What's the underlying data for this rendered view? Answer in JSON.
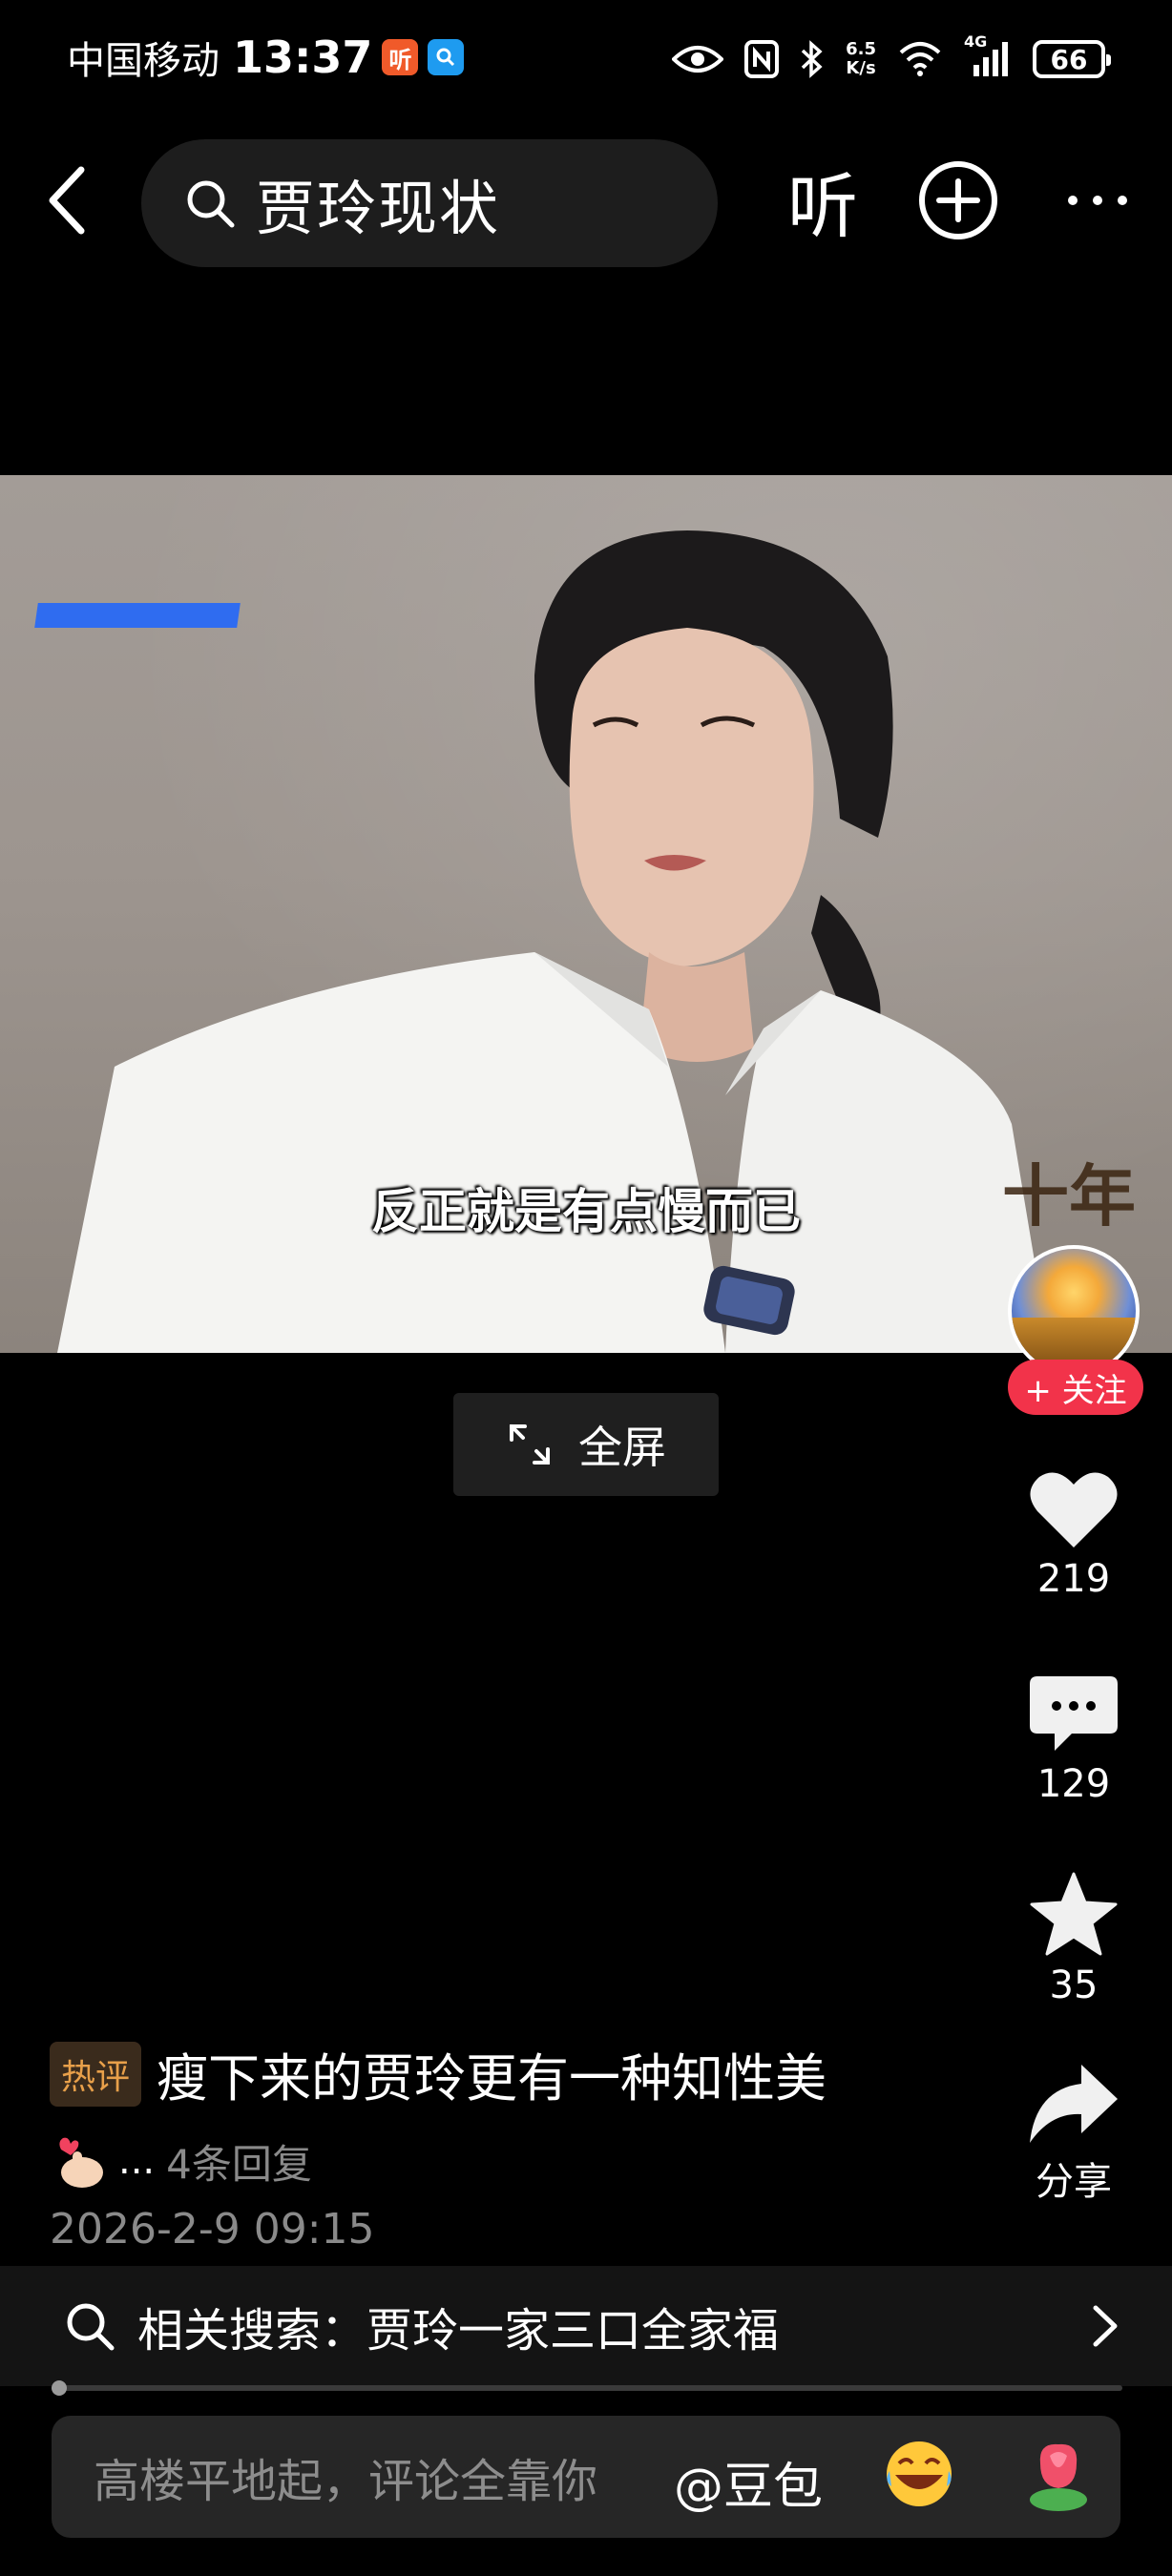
{
  "status_bar": {
    "carrier": "中国移动",
    "time": "13:37",
    "app_badge_1": "听",
    "app_badge_1_color": "#f05a2a",
    "app_badge_2_color": "#1e9bf0",
    "net_speed_top": "6.5",
    "net_speed_bottom": "K/s",
    "network": "4G",
    "battery": "66"
  },
  "top_nav": {
    "search_query": "贾玲现状",
    "listen_label": "听"
  },
  "video": {
    "subtitle": "反正就是有点慢而已",
    "corner_text": "十年"
  },
  "fullscreen": {
    "label": "全屏"
  },
  "rail": {
    "follow_label": "+ 关注",
    "likes": "219",
    "comments": "129",
    "favorites": "35",
    "share_label": "分享"
  },
  "hot_comment": {
    "badge": "热评",
    "text": "瘦下来的贾玲更有一种知性美",
    "ellipsis": "...",
    "replies": "4条回复",
    "timestamp": "2026-2-9 09:15"
  },
  "related_search": {
    "text": "相关搜索：贾玲一家三口全家福"
  },
  "progress": {
    "fraction": 0.005
  },
  "comment_input": {
    "placeholder": "高楼平地起，评论全靠你",
    "mention": "@豆包"
  },
  "colors": {
    "follow_red": "#f2334a",
    "hot_badge_text": "#e8a04a",
    "background": "#000000"
  }
}
